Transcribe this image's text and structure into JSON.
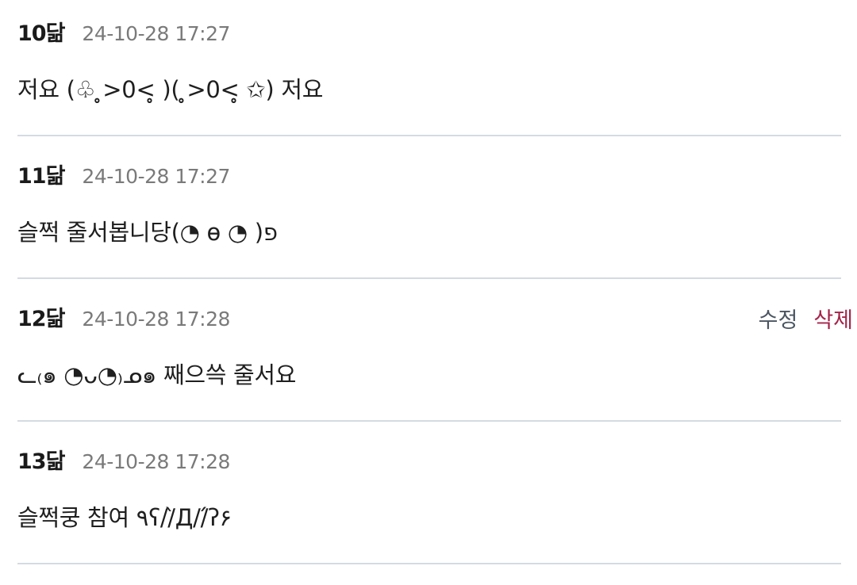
{
  "comments": [
    {
      "author": "10닮",
      "timestamp": "24-10-28 17:27",
      "text": "저요 (♧ ̥̥>0<̥̥ )( ̥̥>0<̥̥ ✩) 저요"
    },
    {
      "author": "11닮",
      "timestamp": "24-10-28 17:27",
      "text": "슬쩍 줄서봅니당(◔ ɵ ◔ )פ"
    },
    {
      "author": "12닮",
      "timestamp": "24-10-28 17:28",
      "text": "ᓚ₍๑ ◔ᴗ◔₎ᓄ๑ 째으쓱 줄서요",
      "actions": {
        "edit_label": "수정",
        "delete_label": "삭제"
      }
    },
    {
      "author": "13닮",
      "timestamp": "24-10-28 17:28",
      "text": "슬쩍쿵 참여 ٩ʕ//̀Д//́ʔ۶"
    }
  ],
  "colors": {
    "edit": "#4a5561",
    "delete": "#a5234a",
    "timestamp": "#7a7a7a",
    "divider": "#d4dbe2"
  }
}
